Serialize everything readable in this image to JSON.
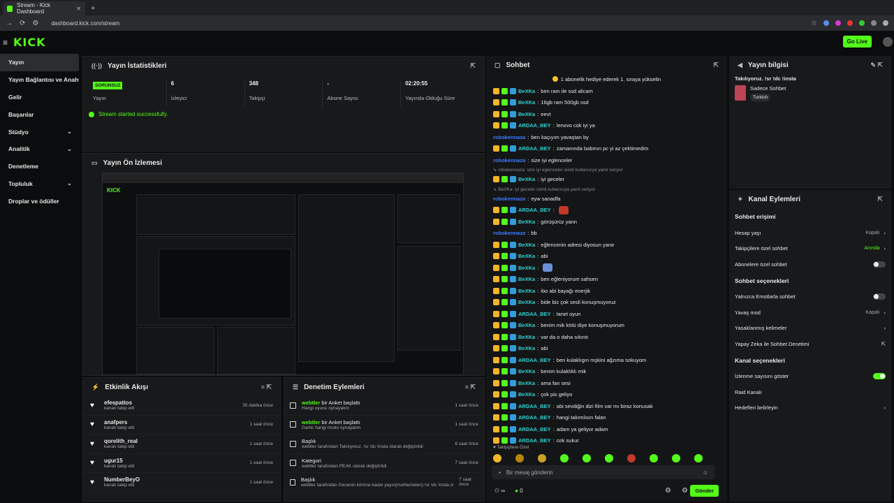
{
  "browser": {
    "tab_title": "Stream - Kick Dashboard",
    "url": "dashboard.kick.com/stream"
  },
  "header": {
    "logo": "KICK",
    "go_live": "Go Live"
  },
  "sidebar": {
    "items": [
      {
        "label": "Yayın",
        "active": true
      },
      {
        "label": "Yayın Bağlantısı ve Anahtarı"
      },
      {
        "label": "Gelir"
      },
      {
        "label": "Başarılar"
      },
      {
        "label": "Stüdyo",
        "chevron": true
      },
      {
        "label": "Analitik",
        "chevron": true
      },
      {
        "label": "Denetleme"
      },
      {
        "label": "Topluluk",
        "chevron": true
      },
      {
        "label": "Droplar ve ödüller"
      }
    ]
  },
  "stats": {
    "title": "Yayın İstatistikleri",
    "status_badge": "SORUNSUZ",
    "status_label": "Yayın",
    "viewers_val": "6",
    "viewers_label": "İzleyici",
    "followers_val": "348",
    "followers_label": "Takipçi",
    "subs_val": "-",
    "subs_label": "Abone Sayısı",
    "uptime_val": "02:20:55",
    "uptime_label": "Yayında Olduğu Süre",
    "success": "Stream started successfully."
  },
  "preview": {
    "title": "Yayın Ön İzlemesi"
  },
  "activity": {
    "title": "Etkinlik Akışı",
    "items": [
      {
        "name": "efespattos",
        "sub": "kanalı takip etti",
        "time": "35 dakika önce"
      },
      {
        "name": "anafpers",
        "sub": "kanalı takip etti",
        "time": "1 saat önce"
      },
      {
        "name": "qorelith_real",
        "sub": "kanalı takip etti",
        "time": "1 saat önce"
      },
      {
        "name": "ugur15",
        "sub": "kanalı takip etti",
        "time": "1 saat önce"
      },
      {
        "name": "NumberBeyO",
        "sub": "kanalı takip etti",
        "time": "1 saat önce"
      }
    ]
  },
  "moderation": {
    "title": "Denetim Eylemleri",
    "items": [
      {
        "user": "webtler",
        "action": "bir Anket başlattı",
        "sub": "Hangi oyunu oynayalım",
        "time": "1 saat önce"
      },
      {
        "user": "webtler",
        "action": "bir Anket başlattı",
        "sub": "Gartic hangi modu oynayalım",
        "time": "1 saat önce"
      },
      {
        "user": "",
        "action": "Başlık",
        "sub": "webtler tarafından Takılıyoruz. !sr !dc !insta olarak değiştirildi",
        "time": "6 saat önce"
      },
      {
        "user": "",
        "action": "Kategori",
        "sub": "webtler tarafından PEAK olarak değiştirildi",
        "time": "7 saat önce"
      },
      {
        "user": "",
        "action": "Başlık",
        "sub": "webtler tarafından Gecenin körüne kadar yayın(muhtemelen) !sr !dc !insta olarak değiştirildi",
        "time": "7 saat önce"
      }
    ]
  },
  "chat": {
    "title": "Sohbet",
    "pinned": "1 abonelik hediye ederek 1. sıraya yükselin",
    "messages": [
      {
        "u": "BeXKa",
        "t": "ben ram ile ssd alicam",
        "c": "cy",
        "b": true
      },
      {
        "u": "BeXKa",
        "t": "16gb ram 500gb ssd",
        "c": "cy",
        "b": true
      },
      {
        "u": "BeXKa",
        "t": "eevt",
        "c": "cy",
        "b": true
      },
      {
        "u": "ARDAA_BEY",
        "t": "lenovo cok iyi ya",
        "c": "cy",
        "b": true
      },
      {
        "u": "robokennaza",
        "t": "ben kaçıyım yavaştan by",
        "c": "bl"
      },
      {
        "u": "ARDAA_BEY",
        "t": "zamanında babmın pc yi az çektimedim",
        "c": "cy",
        "b": true
      },
      {
        "u": "robokennaza",
        "t": "size iyi eglenceler",
        "c": "bl"
      },
      {
        "sm": "↳ robokennaza: size iyi eglenceler isimli kullanıcıya yanıt veriyor"
      },
      {
        "u": "BeXKa",
        "t": "iyi geceler",
        "c": "cy",
        "b": true
      },
      {
        "sm": "↳ BeXKa: iyi geceler isimli kullanıcıya yanıt veriyor"
      },
      {
        "u": "robokennaza",
        "t": "eyw sanadfa",
        "c": "bl"
      },
      {
        "u": "ARDAA_BEY",
        "t": "",
        "c": "cy",
        "b": true,
        "emote": "#c0392b"
      },
      {
        "u": "BeXKa",
        "t": "görüşürüz yann",
        "c": "cy",
        "b": true
      },
      {
        "u": "robokennaza",
        "t": "bb",
        "c": "bl"
      },
      {
        "u": "BeXKa",
        "t": "eğlencenin adresi diyosun yane",
        "c": "cy",
        "b": true
      },
      {
        "u": "BeXKa",
        "t": "abi",
        "c": "cy",
        "b": true
      },
      {
        "u": "BeXKa",
        "t": "",
        "c": "cy",
        "b": true,
        "emote": "#6a8fd6"
      },
      {
        "u": "BeXKa",
        "t": "ben eğleniyorum sahsen",
        "c": "cy",
        "b": true
      },
      {
        "u": "BeXKa",
        "t": "ibo abi bayağı enerjik",
        "c": "cy",
        "b": true
      },
      {
        "u": "BeXKa",
        "t": "bide biz çok sesli konuşmuyoruz",
        "c": "cy",
        "b": true
      },
      {
        "u": "ARDAA_BEY",
        "t": "lanet oyun",
        "c": "cy",
        "b": true
      },
      {
        "u": "BeXKa",
        "t": "benim mik kötü diye konuşmuyorum",
        "c": "cy",
        "b": true
      },
      {
        "u": "BeXKa",
        "t": "var da o daha sıkıntı",
        "c": "cy",
        "b": true
      },
      {
        "u": "BeXKa",
        "t": "abi",
        "c": "cy",
        "b": true
      },
      {
        "u": "ARDAA_BEY",
        "t": "ben kulaklıgın mşkini ağzıma sokuyom",
        "c": "cy",
        "b": true
      },
      {
        "u": "BeXKa",
        "t": "benim kulaklıklı mik",
        "c": "cy",
        "b": true
      },
      {
        "u": "BeXKa",
        "t": "ama fan sesi",
        "c": "cy",
        "b": true
      },
      {
        "u": "BeXKa",
        "t": "çok pis geliyo",
        "c": "cy",
        "b": true
      },
      {
        "u": "ARDAA_BEY",
        "t": "abi sevdiğin dizi film var mı biraz konusak",
        "c": "cy",
        "b": true
      },
      {
        "u": "ARDAA_BEY",
        "t": "hangi takımlısın falan",
        "c": "cy",
        "b": true
      },
      {
        "u": "ARDAA_BEY",
        "t": "adam ya geliyor adam",
        "c": "cy",
        "b": true
      },
      {
        "u": "ARDAA_BEY",
        "t": "cok sukur",
        "c": "cy",
        "b": true
      }
    ],
    "followers_only": "♥ Takipçilere Özel",
    "input_placeholder": "Bir mesaj gönderin",
    "send": "Gönder",
    "count": "0"
  },
  "stream_info": {
    "title": "Yayın bilgisi",
    "stream_title": "Takılıyoruz. !sr !dc !insta",
    "category": "Sadece Sohbet",
    "language": "Turkish"
  },
  "channel_actions": {
    "title": "Kanal Eylemleri",
    "chat_access": "Sohbet erişimi",
    "rows1": [
      {
        "label": "Hesap yaşı",
        "val": "Kapalı"
      },
      {
        "label": "Takipçilere özel sohbet",
        "val": "Anında",
        "green": true
      },
      {
        "label": "Abonelere özel sohbet",
        "toggle": "off"
      }
    ],
    "chat_options": "Sohbet seçenekleri",
    "rows2": [
      {
        "label": "Yalnızca Emotlarla sohbet",
        "toggle": "off"
      },
      {
        "label": "Yavaş mod",
        "val": "Kapalı"
      },
      {
        "label": "Yasaklanmış kelimeler",
        "arrow": true
      },
      {
        "label": "Yapay Zeka ile Sohbet Denetimi",
        "ext": true
      }
    ],
    "channel_options": "Kanal seçenekleri",
    "rows3": [
      {
        "label": "İzlenme sayısını göster",
        "toggle": "on"
      },
      {
        "label": "Raid Kanalı"
      },
      {
        "label": "Hedefleri belirleyin",
        "arrow": true
      }
    ]
  }
}
